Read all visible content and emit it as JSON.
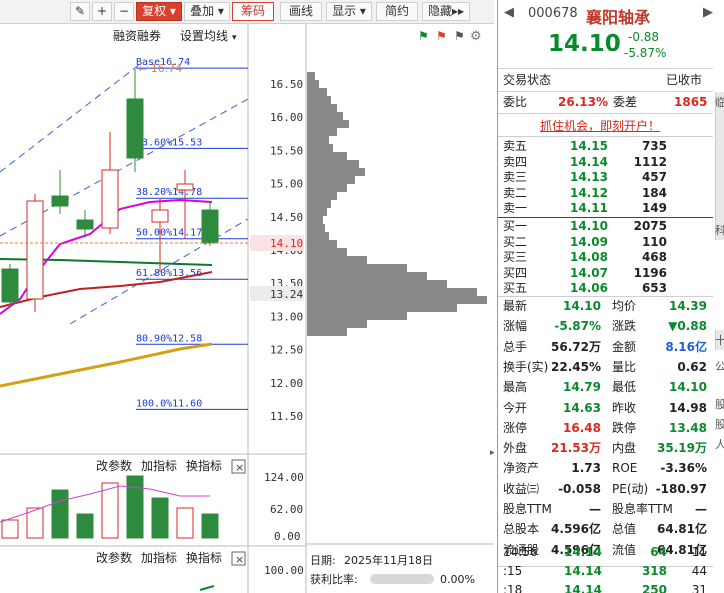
{
  "toolbar": {
    "icon_edit": "✎",
    "plus": "+",
    "minus": "−",
    "fuquan": "复权",
    "diejia": "叠加",
    "chouma": "筹码",
    "huaxian": "画线",
    "xianshi": "显示",
    "jianyue": "简约",
    "yincang": "隐藏"
  },
  "chart_header": {
    "rzrq": "融资融券",
    "set_ma": "设置均线"
  },
  "price_axis": [
    "16.50",
    "16.00",
    "15.50",
    "15.00",
    "14.50",
    "14.00",
    "13.50",
    "13.00",
    "12.50",
    "12.00",
    "11.50"
  ],
  "current_price_tag": "14.10",
  "low_price_tag": "13.24",
  "fib": [
    {
      "label": "Base",
      "price": "16.74"
    },
    {
      "label": "23.60%",
      "price": "15.53"
    },
    {
      "label": "38.20%",
      "price": "14.78"
    },
    {
      "label": "50.00%",
      "price": "14.17"
    },
    {
      "label": "61.80%",
      "price": "13.56"
    },
    {
      "label": "80.90%",
      "price": "12.58"
    },
    {
      "label": "100.0%",
      "price": "11.60"
    }
  ],
  "base_marker": "16.74",
  "sub1": {
    "gcs": "改参数",
    "jia": "加指标",
    "huan": "换指标",
    "close": "×",
    "axis": [
      "124.00",
      "62.00",
      "0.00"
    ]
  },
  "sub2": {
    "gcs": "改参数",
    "jia": "加指标",
    "huan": "换指标",
    "close": "×",
    "axis_top": "100.00"
  },
  "chip_info": {
    "date_label": "日期:",
    "date_value": "2025年11月18日",
    "profit_label": "获利比率:",
    "profit_value": "0.00%",
    "profit_fill": 0.0
  },
  "quote": {
    "code": "000678",
    "name": "襄阳轴承",
    "price": "14.10",
    "change": "-0.88",
    "change_pct": "-5.87%",
    "status_label": "交易状态",
    "status_value": "已收市",
    "weibi_label": "委比",
    "weibi_value": "26.13%",
    "weicha_label": "委差",
    "weicha_value": "1865",
    "promo": "抓住机会，即刻开户！"
  },
  "sells": [
    {
      "label": "卖五",
      "price": "14.15",
      "vol": "735"
    },
    {
      "label": "卖四",
      "price": "14.14",
      "vol": "1112"
    },
    {
      "label": "卖三",
      "price": "14.13",
      "vol": "457"
    },
    {
      "label": "卖二",
      "price": "14.12",
      "vol": "184"
    },
    {
      "label": "卖一",
      "price": "14.11",
      "vol": "149"
    }
  ],
  "buys": [
    {
      "label": "买一",
      "price": "14.10",
      "vol": "2075"
    },
    {
      "label": "买二",
      "price": "14.09",
      "vol": "110"
    },
    {
      "label": "买三",
      "price": "14.08",
      "vol": "468"
    },
    {
      "label": "买四",
      "price": "14.07",
      "vol": "1196"
    },
    {
      "label": "买五",
      "price": "14.06",
      "vol": "653"
    }
  ],
  "stats": [
    {
      "l1": "最新",
      "v1": "14.10",
      "c1": "green",
      "l2": "均价",
      "v2": "14.39",
      "c2": "green"
    },
    {
      "l1": "涨幅",
      "v1": "-5.87%",
      "c1": "green",
      "l2": "涨跌",
      "v2": "▼0.88",
      "c2": "green"
    },
    {
      "l1": "总手",
      "v1": "56.72万",
      "c1": "blk",
      "l2": "金额",
      "v2": "8.16亿",
      "c2": "blue"
    },
    {
      "l1": "换手(实)",
      "v1": "22.45%",
      "c1": "blk",
      "l2": "量比",
      "v2": "0.62",
      "c2": "blk"
    },
    {
      "l1": "最高",
      "v1": "14.79",
      "c1": "green",
      "l2": "最低",
      "v2": "14.10",
      "c2": "green"
    },
    {
      "l1": "今开",
      "v1": "14.63",
      "c1": "green",
      "l2": "昨收",
      "v2": "14.98",
      "c2": "blk"
    },
    {
      "l1": "涨停",
      "v1": "16.48",
      "c1": "red",
      "l2": "跌停",
      "v2": "13.48",
      "c2": "green"
    },
    {
      "l1": "外盘",
      "v1": "21.53万",
      "c1": "red",
      "l2": "内盘",
      "v2": "35.19万",
      "c2": "green"
    },
    {
      "l1": "净资产",
      "v1": "1.73",
      "c1": "blk",
      "l2": "ROE",
      "v2": "-3.36%",
      "c2": "blk"
    },
    {
      "l1": "收益㈢",
      "v1": "-0.058",
      "c1": "blk",
      "l2": "PE(动)",
      "v2": "-180.97",
      "c2": "blk"
    },
    {
      "l1": "股息TTM",
      "v1": "—",
      "c1": "blk",
      "l2": "股息率TTM",
      "v2": "—",
      "c2": "blk"
    },
    {
      "l1": "总股本",
      "v1": "4.596亿",
      "c1": "blk",
      "l2": "总值",
      "v2": "64.81亿",
      "c2": "blk"
    },
    {
      "l1": "流通股",
      "v1": "4.596亿",
      "c1": "blk",
      "l2": "流值",
      "v2": "64.81亿",
      "c2": "blk"
    }
  ],
  "ticks": [
    {
      "time": "14:56",
      "price": "14.14",
      "vol": "64",
      "n": "11"
    },
    {
      "time": ":15",
      "price": "14.14",
      "vol": "318",
      "n": "44"
    },
    {
      "time": ":18",
      "price": "14.14",
      "vol": "250",
      "n": "31"
    }
  ],
  "side_tabs": {
    "right_col1": "临",
    "right_col2": "科",
    "right_col3": "十",
    "right_col4": "公",
    "right_col5": "股",
    "right_col6": "股",
    "right_col7": "人"
  },
  "nav": {
    "prev": "◀",
    "next": "▶"
  },
  "colors": {
    "up": "#d62b1f",
    "down": "#0a8a2c",
    "accent": "#d9412f",
    "blue": "#1a5fd6"
  }
}
